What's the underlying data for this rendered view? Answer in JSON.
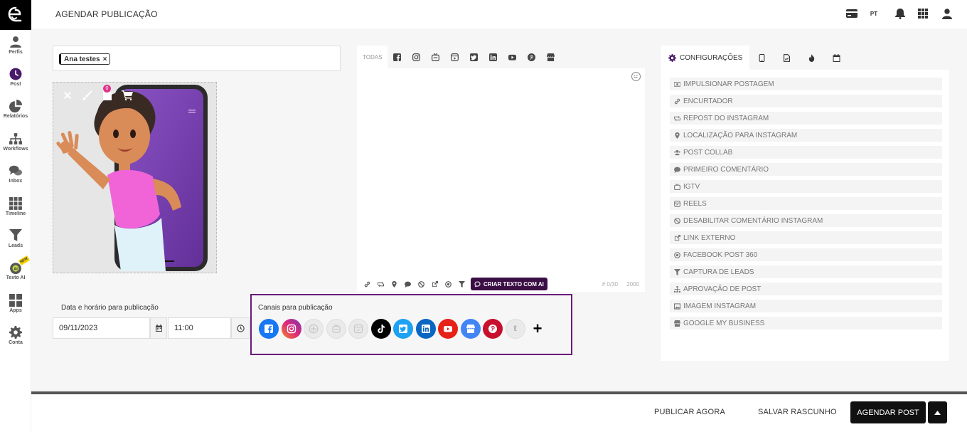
{
  "header": {
    "title": "AGENDAR PUBLICAÇÃO",
    "language": "PT"
  },
  "sidebar": {
    "items": [
      {
        "label": "Perfis",
        "icon": "user-icon"
      },
      {
        "label": "Post",
        "icon": "clock-icon"
      },
      {
        "label": "Relatórios",
        "icon": "pie-chart-icon"
      },
      {
        "label": "Workflows",
        "icon": "sitemap-icon"
      },
      {
        "label": "Inbox",
        "icon": "comments-icon"
      },
      {
        "label": "Timeline",
        "icon": "grid-icon"
      },
      {
        "label": "Leads",
        "icon": "filter-icon"
      },
      {
        "label": "Texto AI",
        "icon": "ai-icon",
        "badge": "NEW"
      },
      {
        "label": "Apps",
        "icon": "apps-icon"
      },
      {
        "label": "Conta",
        "icon": "gear-icon"
      }
    ]
  },
  "profiles": {
    "tag": "Ana testes"
  },
  "media": {
    "badge": "0"
  },
  "editor": {
    "tab_all": "TODAS",
    "char_count": "# 0/30",
    "char_limit": "2000",
    "ai_button": "CRIAR TEXTO COM AI"
  },
  "schedule": {
    "label": "Data e horário para publicação",
    "date": "09/11/2023",
    "time": "11:00"
  },
  "channels": {
    "label": "Canais para publicação",
    "items": [
      {
        "name": "facebook",
        "color": "#1877f2"
      },
      {
        "name": "instagram",
        "color": "#e1306c"
      },
      {
        "name": "igtv",
        "color": "#eaeaea"
      },
      {
        "name": "stories",
        "color": "#eaeaea"
      },
      {
        "name": "reels",
        "color": "#eaeaea"
      },
      {
        "name": "tiktok",
        "color": "#000000"
      },
      {
        "name": "twitter",
        "color": "#1da1f2"
      },
      {
        "name": "linkedin",
        "color": "#0a66c2"
      },
      {
        "name": "youtube",
        "color": "#e62117"
      },
      {
        "name": "google-my-business",
        "color": "#4285f4"
      },
      {
        "name": "pinterest",
        "color": "#c8102e"
      },
      {
        "name": "tumblr",
        "color": "#eaeaea"
      }
    ]
  },
  "config": {
    "tab_label": "CONFIGURAÇÕES",
    "items": [
      {
        "label": "IMPULSIONAR POSTAGEM",
        "icon": "money-icon"
      },
      {
        "label": "ENCURTADOR",
        "icon": "link-icon"
      },
      {
        "label": "REPOST DO INSTAGRAM",
        "icon": "retweet-icon"
      },
      {
        "label": "LOCALIZAÇÃO PARA INSTAGRAM",
        "icon": "map-marker-icon"
      },
      {
        "label": "POST COLLAB",
        "icon": "users-icon"
      },
      {
        "label": "PRIMEIRO COMENTÁRIO",
        "icon": "comment-icon"
      },
      {
        "label": "IGTV",
        "icon": "igtv-icon"
      },
      {
        "label": "REELS",
        "icon": "reels-icon"
      },
      {
        "label": "DESABILITAR COMENTÁRIO INSTAGRAM",
        "icon": "ban-icon"
      },
      {
        "label": "LINK EXTERNO",
        "icon": "external-link-icon"
      },
      {
        "label": "FACEBOOK POST 360",
        "icon": "circle-dot-icon"
      },
      {
        "label": "CAPTURA DE LEADS",
        "icon": "filter-icon"
      },
      {
        "label": "APROVAÇÃO DE POST",
        "icon": "sitemap-icon"
      },
      {
        "label": "IMAGEM INSTAGRAM",
        "icon": "image-icon"
      },
      {
        "label": "GOOGLE MY BUSINESS",
        "icon": "store-icon"
      }
    ]
  },
  "footer": {
    "publish_now": "PUBLICAR AGORA",
    "save_draft": "SALVAR RASCUNHO",
    "schedule": "AGENDAR POST"
  },
  "colors": {
    "accent": "#4a1a6a",
    "highlight_border": "#6a1a7a",
    "dark_button": "#111111"
  }
}
